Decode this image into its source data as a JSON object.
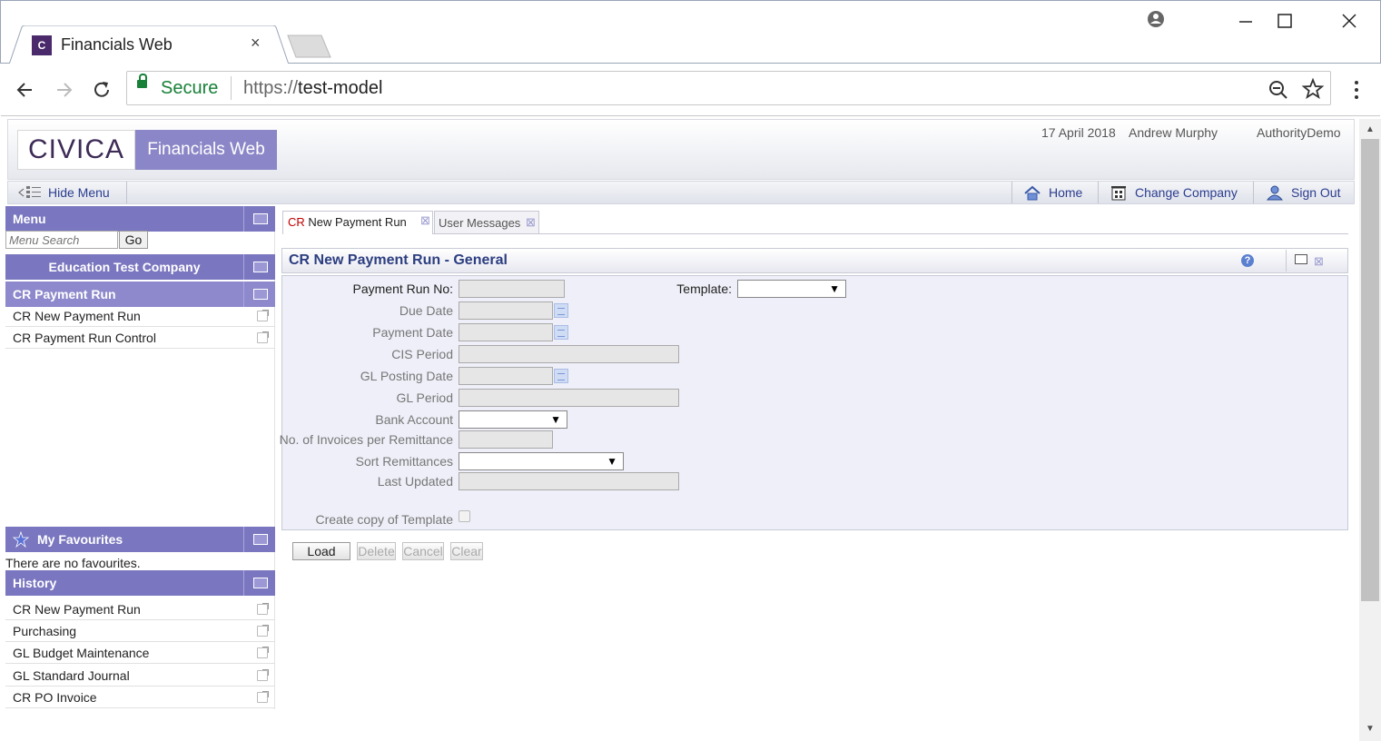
{
  "browser": {
    "tab_title": "Financials Web",
    "tab_favicon_text": "C",
    "tab_close": "×",
    "security_label": "Secure",
    "url_scheme": "https://",
    "url_host": "test-model",
    "icons": [
      "back-icon",
      "forward-icon",
      "reload-icon",
      "lock-icon",
      "zoom-icon",
      "bookmark-star-icon",
      "menu-icon",
      "profile-icon",
      "minimize-icon",
      "maximize-icon",
      "close-icon"
    ]
  },
  "header": {
    "logo_text": "CIVICA",
    "app_name": "Financials Web",
    "date": "17 April 2018",
    "user": "Andrew Murphy",
    "company": "AuthorityDemo"
  },
  "menubar": {
    "hide_menu": "Hide Menu",
    "home": "Home",
    "change_company": "Change Company",
    "sign_out": "Sign Out"
  },
  "sidebar": {
    "menu_title": "Menu",
    "search_placeholder": "Menu Search",
    "go_label": "Go",
    "company_title": "Education Test Company",
    "section_title": "CR Payment Run",
    "items": [
      {
        "label": "CR New Payment Run"
      },
      {
        "label": "CR Payment Run Control"
      }
    ],
    "favourites_title": "My Favourites",
    "favourites_empty": "There are no favourites.",
    "history_title": "History",
    "history": [
      {
        "label": "CR New Payment Run"
      },
      {
        "label": "Purchasing"
      },
      {
        "label": "GL Budget Maintenance"
      },
      {
        "label": "GL Standard Journal"
      },
      {
        "label": "CR PO Invoice"
      }
    ]
  },
  "tabs": [
    {
      "prefix": "CR",
      "label": " New Payment Run"
    },
    {
      "label": "User Messages"
    }
  ],
  "form": {
    "title": "CR New Payment Run - General",
    "labels": {
      "payment_run_no": "Payment Run No:",
      "template": "Template:",
      "due_date": "Due Date",
      "payment_date": "Payment Date",
      "cis_period": "CIS Period",
      "gl_posting_date": "GL Posting Date",
      "gl_period": "GL Period",
      "bank_account": "Bank Account",
      "invoices_per_remittance": "No. of Invoices per Remittance",
      "sort_remittances": "Sort Remittances",
      "last_updated": "Last Updated",
      "create_copy": "Create copy of Template"
    },
    "buttons": {
      "load": "Load",
      "delete": "Delete",
      "cancel": "Cancel",
      "clear": "Clear"
    }
  }
}
